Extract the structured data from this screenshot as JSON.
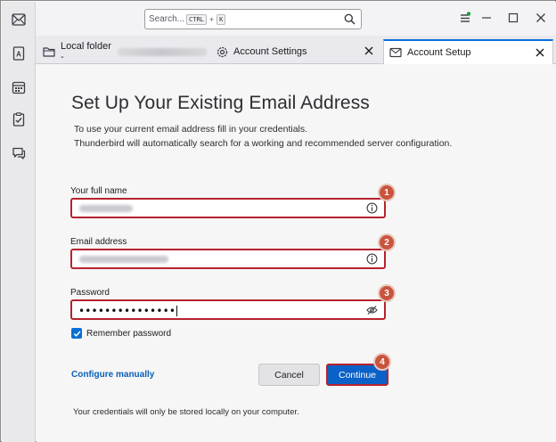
{
  "search": {
    "placeholder": "Search...",
    "shortcut_key1": "CTRL",
    "shortcut_plus": "+",
    "shortcut_key2": "K"
  },
  "tabs": [
    {
      "label": "Local folder -",
      "icon": "folder-icon",
      "active": false
    },
    {
      "label": "Account Settings",
      "icon": "gear-icon",
      "active": false
    },
    {
      "label": "Account Setup",
      "icon": "mail-setup-icon",
      "active": true
    }
  ],
  "spaces": [
    "mail-icon",
    "address-book-icon",
    "calendar-icon",
    "tasks-icon",
    "chat-icon"
  ],
  "setup": {
    "title": "Set Up Your Existing Email Address",
    "description_line1": "To use your current email address fill in your credentials.",
    "description_line2": "Thunderbird will automatically search for a working and recommended server configuration.",
    "fullname_label": "Your full name",
    "email_label": "Email address",
    "password_label": "Password",
    "password_value": "•••••••••••••••",
    "remember_label": "Remember password",
    "remember_checked": true,
    "configure_link": "Configure manually",
    "cancel_label": "Cancel",
    "continue_label": "Continue",
    "footer_note": "Your credentials will only be stored locally on your computer."
  },
  "badges": [
    "1",
    "2",
    "3",
    "4"
  ],
  "colors": {
    "accent": "#0b61c7",
    "highlight_border": "#b7222c",
    "badge": "#c9543e",
    "link": "#0a5fb8"
  }
}
